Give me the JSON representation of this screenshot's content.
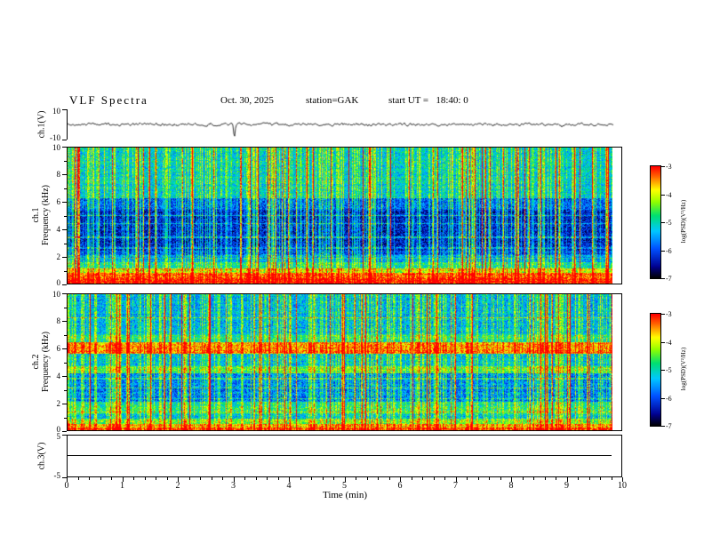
{
  "header": {
    "title": "VLF Spectra",
    "date": "Oct. 30, 2025",
    "station": "station=GAK",
    "start_ut": "start UT =   18:40: 0"
  },
  "xaxis": {
    "label": "Time (min)",
    "range_min": [
      0,
      10
    ],
    "ticks": [
      0,
      1,
      2,
      3,
      4,
      5,
      6,
      7,
      8,
      9,
      10
    ]
  },
  "colorbar": {
    "label": "log(PSD)(V²/Hz)",
    "ticks": [
      -3,
      -4,
      -5,
      -6,
      -7
    ],
    "range_log_psd": [
      -3,
      -7
    ],
    "colormap_stops": [
      {
        "t": 0.0,
        "color": "#000006"
      },
      {
        "t": 0.1,
        "color": "#000090"
      },
      {
        "t": 0.26,
        "color": "#0050ff"
      },
      {
        "t": 0.42,
        "color": "#00c8ff"
      },
      {
        "t": 0.56,
        "color": "#00e070"
      },
      {
        "t": 0.68,
        "color": "#90ff00"
      },
      {
        "t": 0.79,
        "color": "#ffff00"
      },
      {
        "t": 0.89,
        "color": "#ff8000"
      },
      {
        "t": 1.0,
        "color": "#ff0000"
      }
    ]
  },
  "chart_data": [
    {
      "panel": "ch1-waveform",
      "type": "line",
      "ylabel": "ch.1(V)",
      "ylim": [
        -10,
        10
      ],
      "yticks": [
        10,
        -10
      ],
      "signal": {
        "baseline_v": 0,
        "noise_amp_v": 1.6,
        "spikes": [
          {
            "t_min": 3.02,
            "amp_v": -8.5
          }
        ],
        "end_min": 9.85
      }
    },
    {
      "panel": "ch1-spectrogram",
      "type": "heatmap",
      "ylabel_lines": [
        "ch.1",
        "Frequency (kHz)"
      ],
      "freq_range_khz": [
        0,
        10
      ],
      "yticks": [
        10,
        8,
        6,
        4,
        2,
        0
      ],
      "psd_range_log": [
        -7,
        -3
      ],
      "background_level": 0.16,
      "bands": [
        {
          "f0": 0.0,
          "f1": 0.35,
          "level": 0.97
        },
        {
          "f0": 0.35,
          "f1": 0.75,
          "level": 0.88
        },
        {
          "f0": 0.75,
          "f1": 1.1,
          "level": 0.72
        },
        {
          "f0": 1.1,
          "f1": 1.55,
          "level": 0.5
        },
        {
          "f0": 1.55,
          "f1": 2.1,
          "level": 0.34
        },
        {
          "f0": 2.1,
          "f1": 2.4,
          "level": 0.22
        },
        {
          "f0": 2.4,
          "f1": 5.4,
          "level": 0.16
        },
        {
          "f0": 5.4,
          "f1": 6.3,
          "level": 0.26
        },
        {
          "f0": 6.3,
          "f1": 10.0,
          "level": 0.44
        }
      ],
      "carrier_lines_khz": [
        1.85,
        2.6,
        3.4,
        4.4,
        5.0
      ],
      "impulses": {
        "density": 0.42,
        "strong_fraction": 0.1
      },
      "end_min": 9.85
    },
    {
      "panel": "ch2-spectrogram",
      "type": "heatmap",
      "ylabel_lines": [
        "ch.2",
        "Frequency (kHz)"
      ],
      "freq_range_khz": [
        0,
        10
      ],
      "yticks": [
        10,
        8,
        6,
        4,
        2,
        0
      ],
      "psd_range_log": [
        -7,
        -3
      ],
      "background_level": 0.3,
      "bands": [
        {
          "f0": 0.0,
          "f1": 0.15,
          "level": 0.92
        },
        {
          "f0": 0.15,
          "f1": 0.45,
          "level": 0.78
        },
        {
          "f0": 0.45,
          "f1": 0.8,
          "level": 0.62
        },
        {
          "f0": 0.8,
          "f1": 1.15,
          "level": 0.4
        },
        {
          "f0": 1.15,
          "f1": 2.05,
          "level": 0.5
        },
        {
          "f0": 2.05,
          "f1": 4.2,
          "level": 0.3
        },
        {
          "f0": 4.2,
          "f1": 4.7,
          "level": 0.58
        },
        {
          "f0": 4.7,
          "f1": 5.6,
          "level": 0.4
        },
        {
          "f0": 5.6,
          "f1": 6.45,
          "level": 0.85
        },
        {
          "f0": 6.45,
          "f1": 7.1,
          "level": 0.5
        },
        {
          "f0": 7.1,
          "f1": 10.0,
          "level": 0.38
        }
      ],
      "carrier_lines_khz": [
        1.3,
        2.3,
        3.1,
        3.8,
        8.3
      ],
      "impulses": {
        "density": 0.45,
        "strong_fraction": 0.1
      },
      "end_min": 9.85
    },
    {
      "panel": "ch3-waveform",
      "type": "line",
      "ylabel": "ch.3(V)",
      "ylim": [
        -5,
        5
      ],
      "yticks": [
        5,
        -5
      ],
      "signal": {
        "baseline_v": 0,
        "flat": true,
        "end_min": 9.85
      }
    }
  ]
}
